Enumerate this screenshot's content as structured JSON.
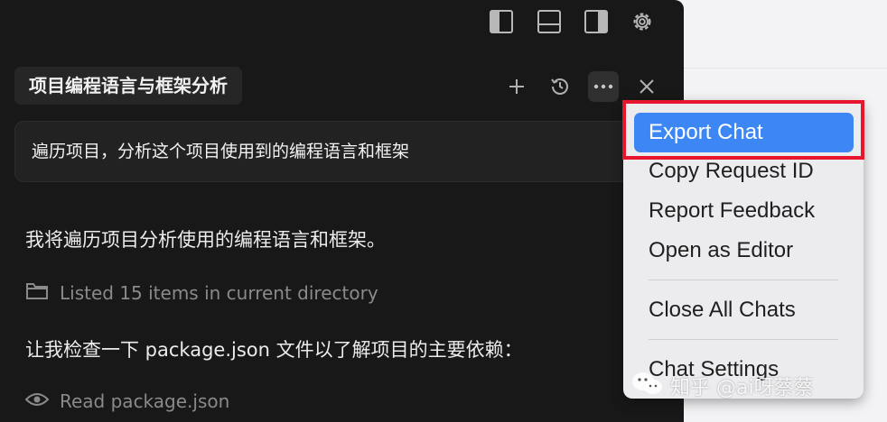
{
  "chat": {
    "tab_title": "项目编程语言与框架分析",
    "user_prompt": "遍历项目，分析这个项目使用到的编程语言和框架",
    "assistant_intro": "我将遍历项目分析使用的编程语言和框架。",
    "tool_list_dir": "Listed 15 items in current directory",
    "assistant_followup": "让我检查一下 package.json 文件以了解项目的主要依赖：",
    "tool_read_file": "Read package.json"
  },
  "topbar_icons": [
    "sidebar-left-icon",
    "panel-bottom-icon",
    "sidebar-right-icon",
    "gear-icon"
  ],
  "header_icons": [
    "plus-icon",
    "history-icon",
    "more-icon",
    "close-icon"
  ],
  "menu": {
    "items": [
      "Export Chat",
      "Copy Request ID",
      "Report Feedback",
      "Open as Editor",
      "Close All Chats",
      "Chat Settings"
    ]
  },
  "watermark": "知乎 @ai呀蔡蔡",
  "colors": {
    "panel_bg": "#181818",
    "menu_bg": "#ececef",
    "menu_highlight": "#3d87f5",
    "callout_border": "#e8162d"
  }
}
